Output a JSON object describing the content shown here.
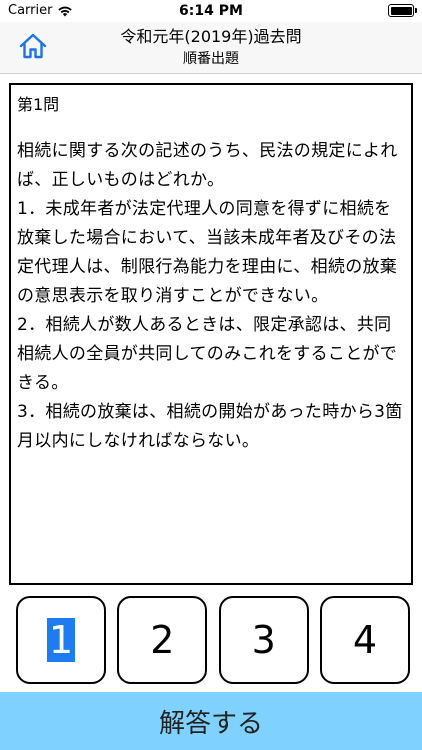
{
  "status_bar": {
    "carrier": "Carrier",
    "time": "6:14 PM",
    "icons": [
      "wifi-icon",
      "battery-icon"
    ]
  },
  "header": {
    "home_icon": "home-icon",
    "title": "令和元年(2019年)過去問",
    "subtitle": "順番出題"
  },
  "question": {
    "number": "第1問",
    "stem": "相続に関する次の記述のうち、民法の規定によれば、正しいものはどれか。",
    "choices": [
      "1．未成年者が法定代理人の同意を得ずに相続を放棄した場合において、当該未成年者及びその法定代理人は、制限行為能力を理由に、相続の放棄の意思表示を取り消すことができない。",
      "2．相続人が数人あるときは、限定承認は、共同相続人の全員が共同してのみこれをすることができる。",
      "3．相続の放棄は、相続の開始があった時から3箇月以内にしなければならない。"
    ]
  },
  "answers": {
    "options": [
      "1",
      "2",
      "3",
      "4"
    ],
    "selected": "1",
    "selected_color": "#1f7bf0"
  },
  "submit": {
    "label": "解答する",
    "color": "#7fd1ff"
  }
}
